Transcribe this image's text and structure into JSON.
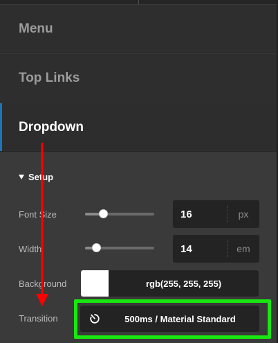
{
  "nav": {
    "items": [
      {
        "label": "Menu"
      },
      {
        "label": "Top Links"
      },
      {
        "label": "Dropdown"
      }
    ]
  },
  "setup": {
    "title": "Setup",
    "font_size": {
      "label": "Font Size",
      "value": "16",
      "unit": "px",
      "slider_fraction": 0.26
    },
    "width": {
      "label": "Width",
      "value": "14",
      "unit": "em",
      "slider_fraction": 0.16
    },
    "background": {
      "label": "Background",
      "value": "rgb(255, 255, 255)",
      "color": "#ffffff"
    },
    "transition": {
      "label": "Transition",
      "value": "500ms / Material Standard"
    }
  },
  "colors": {
    "accent": "#1e73be",
    "highlight": "#18e80f",
    "annotation_arrow": "#ff0000"
  },
  "icons": {
    "transition": "timer-icon",
    "section_toggle": "caret-down-icon"
  }
}
